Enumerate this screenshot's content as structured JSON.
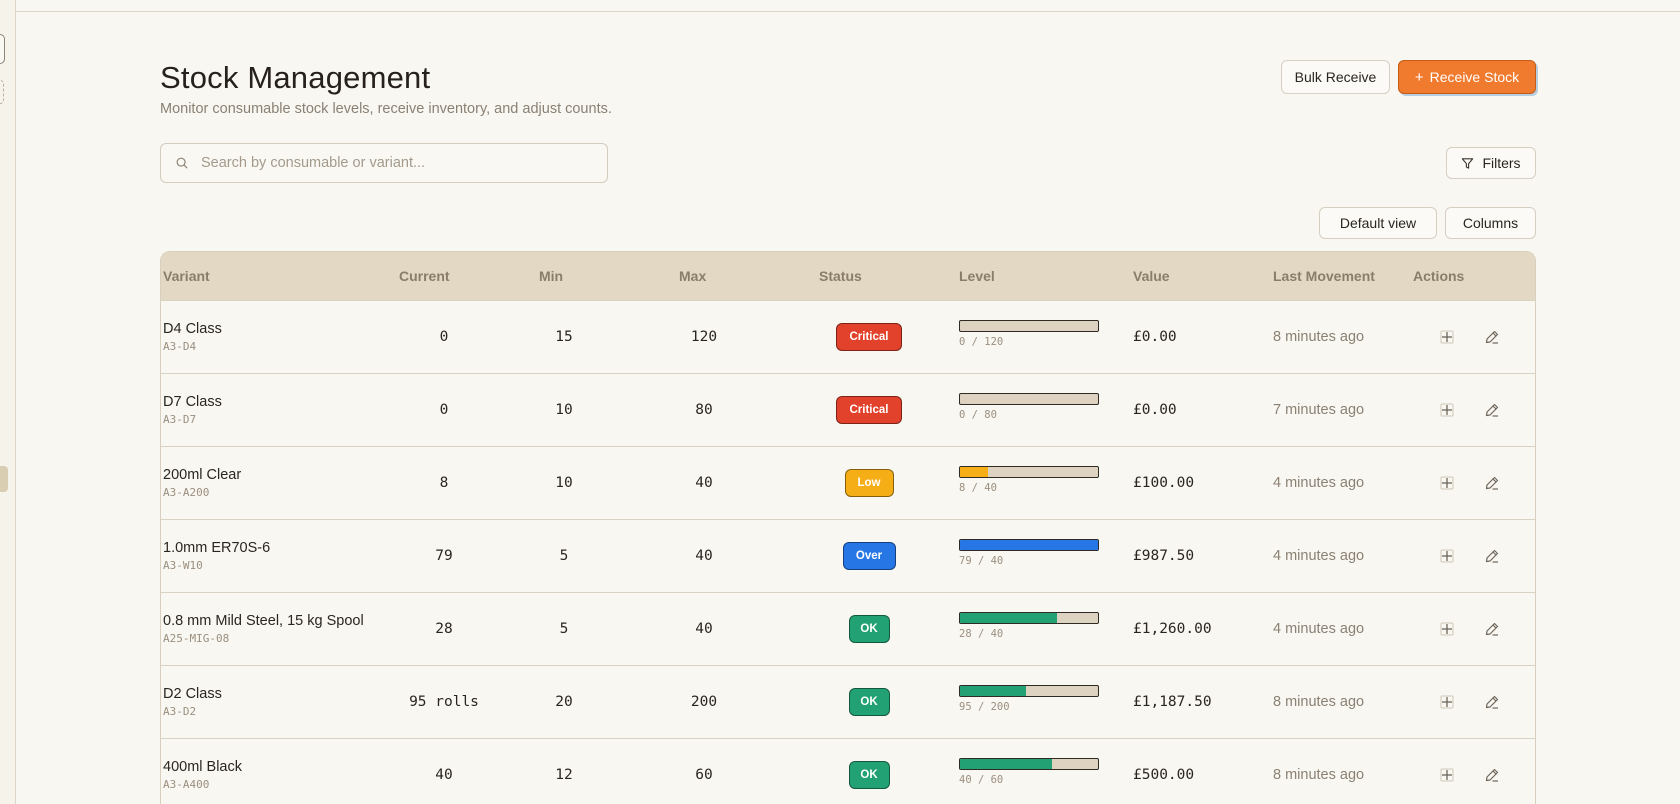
{
  "page": {
    "title": "Stock Management",
    "subtitle": "Monitor consumable stock levels, receive inventory, and adjust counts."
  },
  "toolbar": {
    "bulk_receive_label": "Bulk Receive",
    "receive_stock_label": "Receive Stock",
    "filters_label": "Filters",
    "default_view_label": "Default view",
    "columns_label": "Columns"
  },
  "search": {
    "placeholder": "Search by consumable or variant...",
    "value": ""
  },
  "table": {
    "headers": {
      "variant": "Variant",
      "current": "Current",
      "min": "Min",
      "max": "Max",
      "status": "Status",
      "level": "Level",
      "value": "Value",
      "last_movement": "Last Movement",
      "actions": "Actions"
    },
    "rows": [
      {
        "name": "D4 Class",
        "code": "A3-D4",
        "current": "0",
        "min": "15",
        "max": "120",
        "status": "Critical",
        "status_kind": "critical",
        "level_label": "0 / 120",
        "level_fraction": 0,
        "value": "£0.00",
        "last_movement": "8 minutes ago"
      },
      {
        "name": "D7 Class",
        "code": "A3-D7",
        "current": "0",
        "min": "10",
        "max": "80",
        "status": "Critical",
        "status_kind": "critical",
        "level_label": "0 / 80",
        "level_fraction": 0,
        "value": "£0.00",
        "last_movement": "7 minutes ago"
      },
      {
        "name": "200ml Clear",
        "code": "A3-A200",
        "current": "8",
        "min": "10",
        "max": "40",
        "status": "Low",
        "status_kind": "low",
        "level_label": "8 / 40",
        "level_fraction": 0.2,
        "value": "£100.00",
        "last_movement": "4 minutes ago"
      },
      {
        "name": "1.0mm ER70S-6",
        "code": "A3-W10",
        "current": "79",
        "min": "5",
        "max": "40",
        "status": "Over",
        "status_kind": "over",
        "level_label": "79 / 40",
        "level_fraction": 1,
        "value": "£987.50",
        "last_movement": "4 minutes ago"
      },
      {
        "name": "0.8 mm Mild Steel, 15 kg Spool",
        "code": "A25-MIG-08",
        "current": "28",
        "min": "5",
        "max": "40",
        "status": "OK",
        "status_kind": "ok",
        "level_label": "28 / 40",
        "level_fraction": 0.7,
        "value": "£1,260.00",
        "last_movement": "4 minutes ago"
      },
      {
        "name": "D2 Class",
        "code": "A3-D2",
        "current": "95 rolls",
        "min": "20",
        "max": "200",
        "status": "OK",
        "status_kind": "ok",
        "level_label": "95 / 200",
        "level_fraction": 0.475,
        "value": "£1,187.50",
        "last_movement": "8 minutes ago"
      },
      {
        "name": "400ml Black",
        "code": "A3-A400",
        "current": "40",
        "min": "12",
        "max": "60",
        "status": "OK",
        "status_kind": "ok",
        "level_label": "40 / 60",
        "level_fraction": 0.667,
        "value": "£500.00",
        "last_movement": "8 minutes ago"
      }
    ]
  },
  "colors": {
    "accent": "#f07a2d",
    "critical": "#e2412c",
    "low": "#f5ae16",
    "over": "#2676e6",
    "ok": "#22a274"
  },
  "icons": {
    "search": "search-icon",
    "filter": "filter-icon",
    "plus": "plus-icon",
    "receive": "crosshair-plus-icon",
    "edit": "pencil-icon"
  }
}
